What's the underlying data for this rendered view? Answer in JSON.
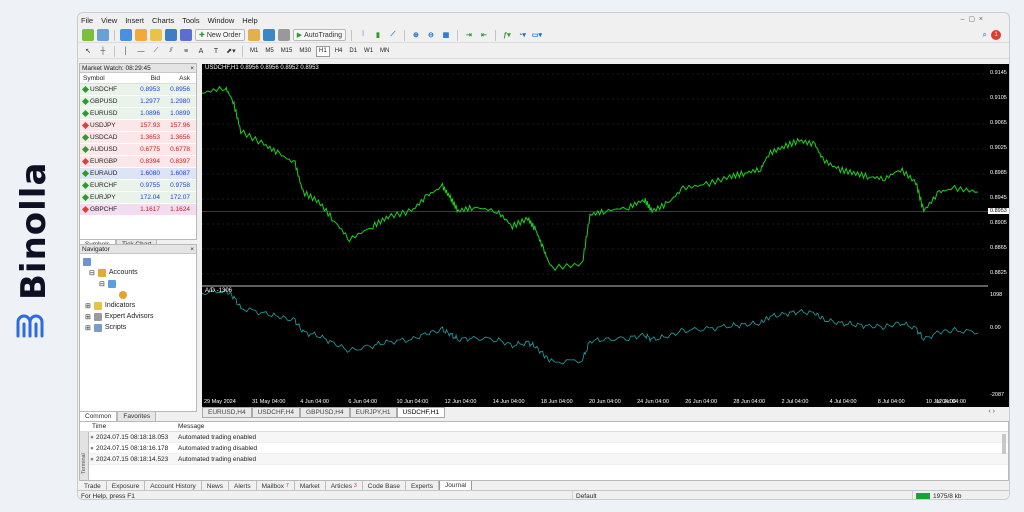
{
  "brand": {
    "name": "Binolla",
    "color": "#0f1023",
    "logo_color": "#2d6cdf"
  },
  "menu": [
    "File",
    "View",
    "Insert",
    "Charts",
    "Tools",
    "Window",
    "Help"
  ],
  "toolbar": {
    "new_order": "New Order",
    "autotrading": "AutoTrading",
    "timeframes": [
      "M1",
      "M5",
      "M15",
      "M30",
      "H1",
      "H4",
      "D1",
      "W1",
      "MN"
    ],
    "active_timeframe": "H1"
  },
  "market_watch": {
    "title": "Market Watch: 08:29:45",
    "columns": {
      "symbol": "Symbol",
      "bid": "Bid",
      "ask": "Ask"
    },
    "rows": [
      {
        "symbol": "USDCHF",
        "bid": "0.8953",
        "ask": "0.8956",
        "bg": "#eaf3ea",
        "bidc": "#1c3fd6",
        "dot": "#2d9a2d"
      },
      {
        "symbol": "GBPUSD",
        "bid": "1.2977",
        "ask": "1.2980",
        "bg": "#eaf3ea",
        "bidc": "#1c3fd6",
        "dot": "#2d9a2d"
      },
      {
        "symbol": "EURUSD",
        "bid": "1.0896",
        "ask": "1.0899",
        "bg": "#eaf3ea",
        "bidc": "#1c3fd6",
        "dot": "#2d9a2d"
      },
      {
        "symbol": "USDJPY",
        "bid": "157.93",
        "ask": "157.96",
        "bg": "#fbe7e7",
        "bidc": "#c82020",
        "dot": "#d84040"
      },
      {
        "symbol": "USDCAD",
        "bid": "1.3653",
        "ask": "1.3656",
        "bg": "#fbe7e7",
        "bidc": "#c82020",
        "dot": "#2d9a2d"
      },
      {
        "symbol": "AUDUSD",
        "bid": "0.6775",
        "ask": "0.6778",
        "bg": "#fbe7e7",
        "bidc": "#c82020",
        "dot": "#2d9a2d"
      },
      {
        "symbol": "EURGBP",
        "bid": "0.8394",
        "ask": "0.8397",
        "bg": "#fbe7e7",
        "bidc": "#c82020",
        "dot": "#d84040"
      },
      {
        "symbol": "EURAUD",
        "bid": "1.6080",
        "ask": "1.6087",
        "bg": "#dde4f6",
        "bidc": "#1c3fd6",
        "dot": "#2d9a2d"
      },
      {
        "symbol": "EURCHF",
        "bid": "0.9755",
        "ask": "0.9758",
        "bg": "#eaf3ea",
        "bidc": "#1c3fd6",
        "dot": "#2d9a2d"
      },
      {
        "symbol": "EURJPY",
        "bid": "172.04",
        "ask": "172.07",
        "bg": "#eaf3ea",
        "bidc": "#1c3fd6",
        "dot": "#2d9a2d"
      },
      {
        "symbol": "GBPCHF",
        "bid": "1.1617",
        "ask": "1.1624",
        "bg": "#f3dcef",
        "bidc": "#c82020",
        "dot": "#d84040"
      }
    ],
    "tabs": [
      "Symbols",
      "Tick Chart"
    ]
  },
  "navigator": {
    "title": "Navigator",
    "items": [
      "Accounts",
      "Indicators",
      "Expert Advisors",
      "Scripts"
    ],
    "tabs": [
      "Common",
      "Favorites"
    ]
  },
  "chart": {
    "header": "USDCHF,H1  0.8956 0.8956 0.8952 0.8953",
    "indicator_label": "A/D -1306",
    "price_color": "#19d219",
    "indicator_color": "#1fa3a3",
    "current_price": "0.8953",
    "y_ticks": [
      "0.9145",
      "0.9105",
      "0.9065",
      "0.9025",
      "0.8985",
      "0.8945",
      "0.8905",
      "0.8865",
      "0.8825"
    ],
    "ind_ticks": [
      "1098",
      "0.00",
      "-2087"
    ],
    "x_labels": [
      "29 May 2024",
      "31 May 04:00",
      "4 Jun 04:00",
      "6 Jun 04:00",
      "10 Jun 04:00",
      "12 Jun 04:00",
      "14 Jun 04:00",
      "18 Jun 04:00",
      "20 Jun 04:00",
      "24 Jun 04:00",
      "26 Jun 04:00",
      "28 Jun 04:00",
      "2 Jul 04:00",
      "4 Jul 04:00",
      "8 Jul 04:00",
      "10 Jul 04:00",
      "12 Jul 04:00"
    ],
    "tabs": [
      "EURUSD,H4",
      "USDCHF,H4",
      "GBPUSD,H4",
      "EURJPY,H1",
      "USDCHF,H1"
    ],
    "active_tab": "USDCHF,H1"
  },
  "terminal": {
    "side_label": "Terminal",
    "columns": {
      "time": "Time",
      "message": "Message"
    },
    "rows": [
      {
        "time": "2024.07.15 08:18:18.053",
        "message": "Automated trading enabled"
      },
      {
        "time": "2024.07.15 08:18:16.178",
        "message": "Automated trading disabled"
      },
      {
        "time": "2024.07.15 08:18:14.523",
        "message": "Automated trading enabled"
      }
    ],
    "tabs": [
      "Trade",
      "Exposure",
      "Account History",
      "News",
      "Alerts",
      "Mailbox",
      "Market",
      "Articles",
      "Code Base",
      "Experts",
      "Journal"
    ],
    "mailbox_badge": "7",
    "articles_badge": "3",
    "active_tab": "Journal"
  },
  "status": {
    "help": "For Help, press F1",
    "profile": "Default",
    "traffic": "1975/8 kb"
  }
}
